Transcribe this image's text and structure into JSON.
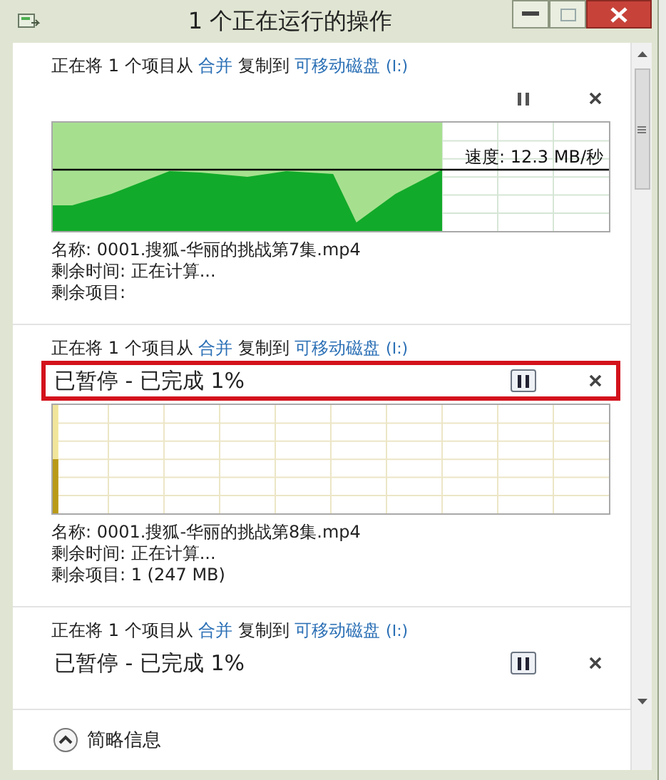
{
  "window": {
    "title": "1 个正在运行的操作"
  },
  "operations": [
    {
      "prefix": "正在将 1 个项目从",
      "source": "合并",
      "middle": "复制到",
      "destination": "可移动磁盘",
      "drive": "(I:)",
      "paused": false,
      "level": 0.7,
      "speed": "速度: 12.3 MB/秒",
      "details": [
        "名称: 0001.搜狐-华丽的挑战第7集.mp4",
        "剩余时间: 正在计算...",
        "剩余项目:"
      ]
    },
    {
      "prefix": "正在将 1 个项目从",
      "source": "合并",
      "middle": "复制到",
      "destination": "可移动磁盘",
      "drive": "(I:)",
      "status": "已暂停 - 已完成 1%",
      "paused": true,
      "highlighted": true,
      "level": 0.01,
      "details": [
        "名称: 0001.搜狐-华丽的挑战第8集.mp4",
        "剩余时间: 正在计算...",
        "剩余项目: 1 (247 MB)"
      ]
    },
    {
      "prefix": "正在将 1 个项目从",
      "source": "合并",
      "middle": "复制到",
      "destination": "可移动磁盘",
      "drive": "(I:)",
      "status": "已暂停 - 已完成 1%",
      "paused": true
    }
  ],
  "footer": {
    "toggle": "简略信息"
  }
}
